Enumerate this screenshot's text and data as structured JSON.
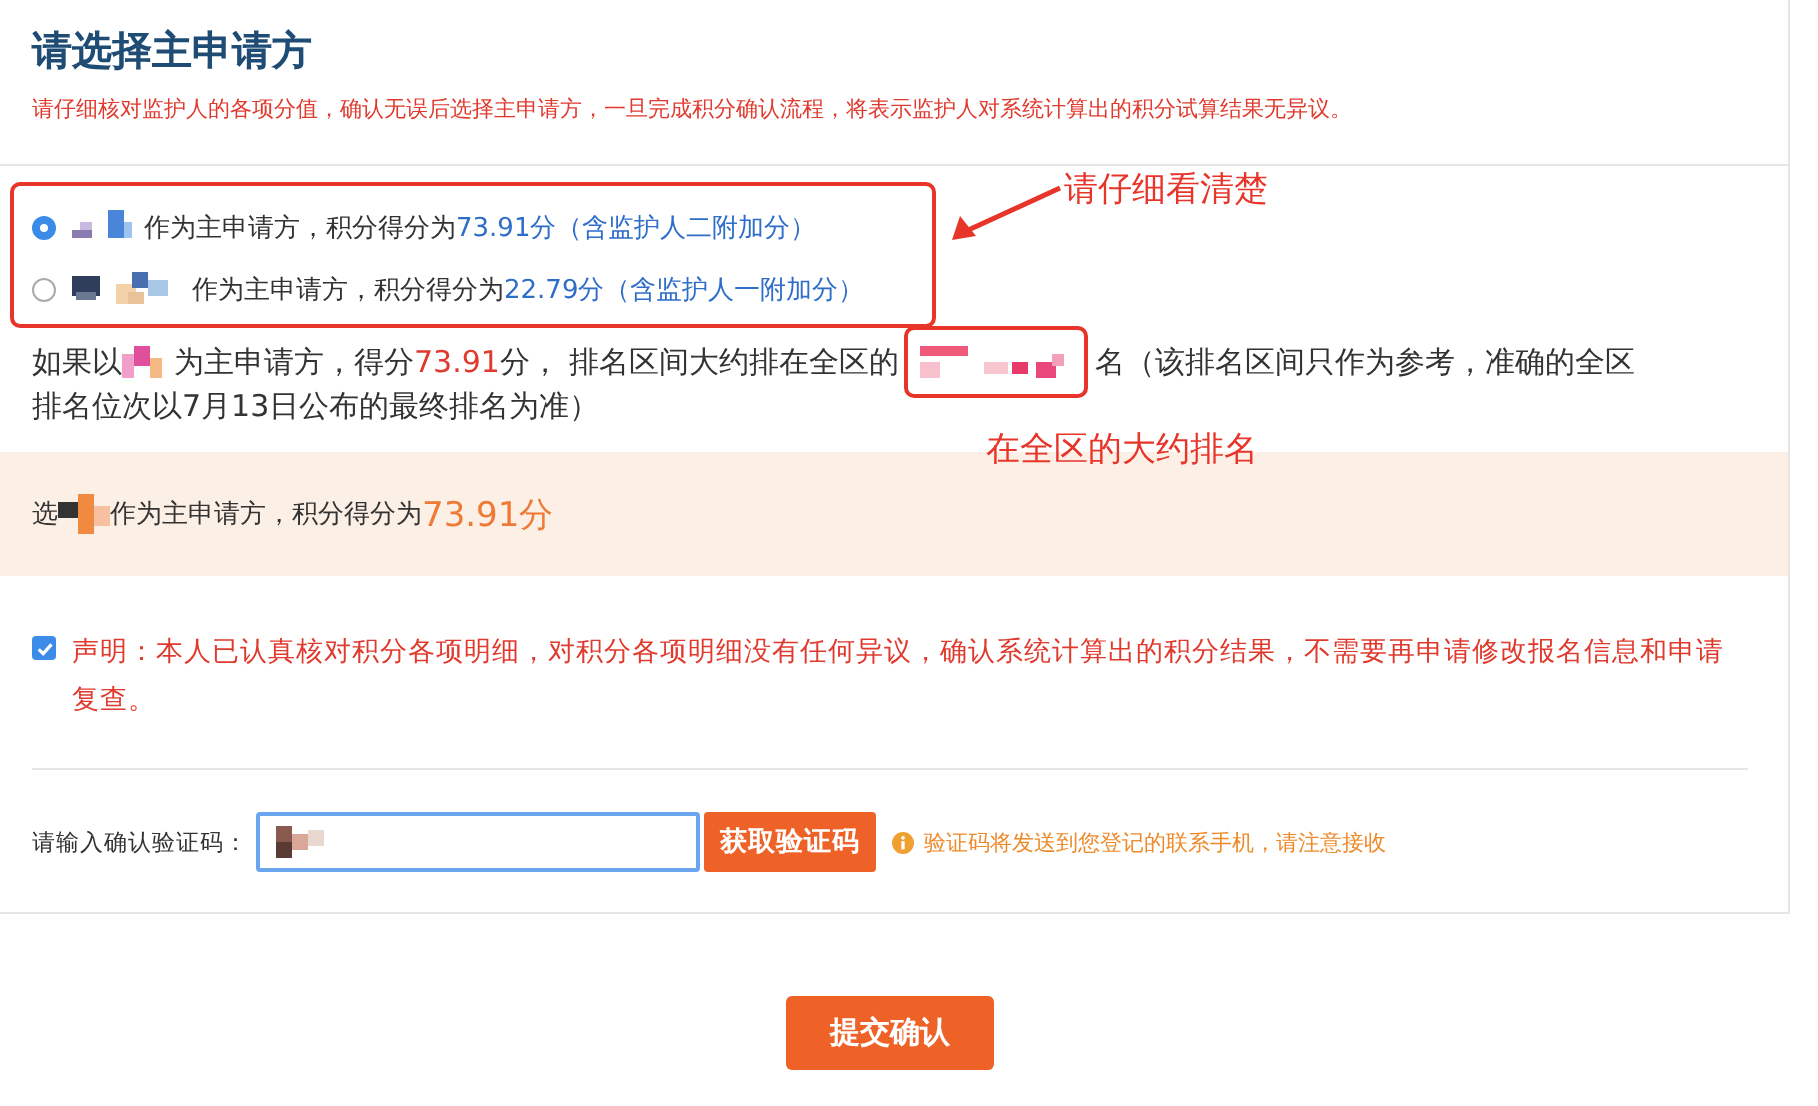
{
  "title": "请选择主申请方",
  "notice": "请仔细核对监护人的各项分值，确认无误后选择主申请方，一旦完成积分确认流程，将表示监护人对系统计算出的积分试算结果无异议。",
  "applicants": [
    {
      "selected": true,
      "text": "作为主申请方，积分得分为",
      "score": "73.91分",
      "note": "（含监护人二附加分）"
    },
    {
      "selected": false,
      "text": "作为主申请方，积分得分为",
      "score": "22.79分",
      "note": "（含监护人一附加分）"
    }
  ],
  "ranking": {
    "before": "如果以",
    "middle": "为主申请方，得分 ",
    "score": "73.91",
    "after_score": "分， 排名区间大约排在全区的",
    "end": "名（该排名区间只作为参考，准确的全区",
    "line2": "排名位次以7月13日公布的最终排名为准）"
  },
  "selection_summary": {
    "before": "选",
    "after": "作为主申请方，积分得分为",
    "score": "73.91分"
  },
  "declaration": {
    "checked": true,
    "text": "声明：本人已认真核对积分各项明细，对积分各项明细没有任何异议，确认系统计算出的积分结果，不需要再申请修改报名信息和申请复查。"
  },
  "verification": {
    "label": "请输入确认验证码：",
    "button": "获取验证码",
    "hint": "验证码将发送到您登记的联系手机，请注意接收"
  },
  "submit": "提交确认",
  "annotations": [
    {
      "text": "请仔细看清楚"
    },
    {
      "text": "在全区的大约排名"
    }
  ]
}
